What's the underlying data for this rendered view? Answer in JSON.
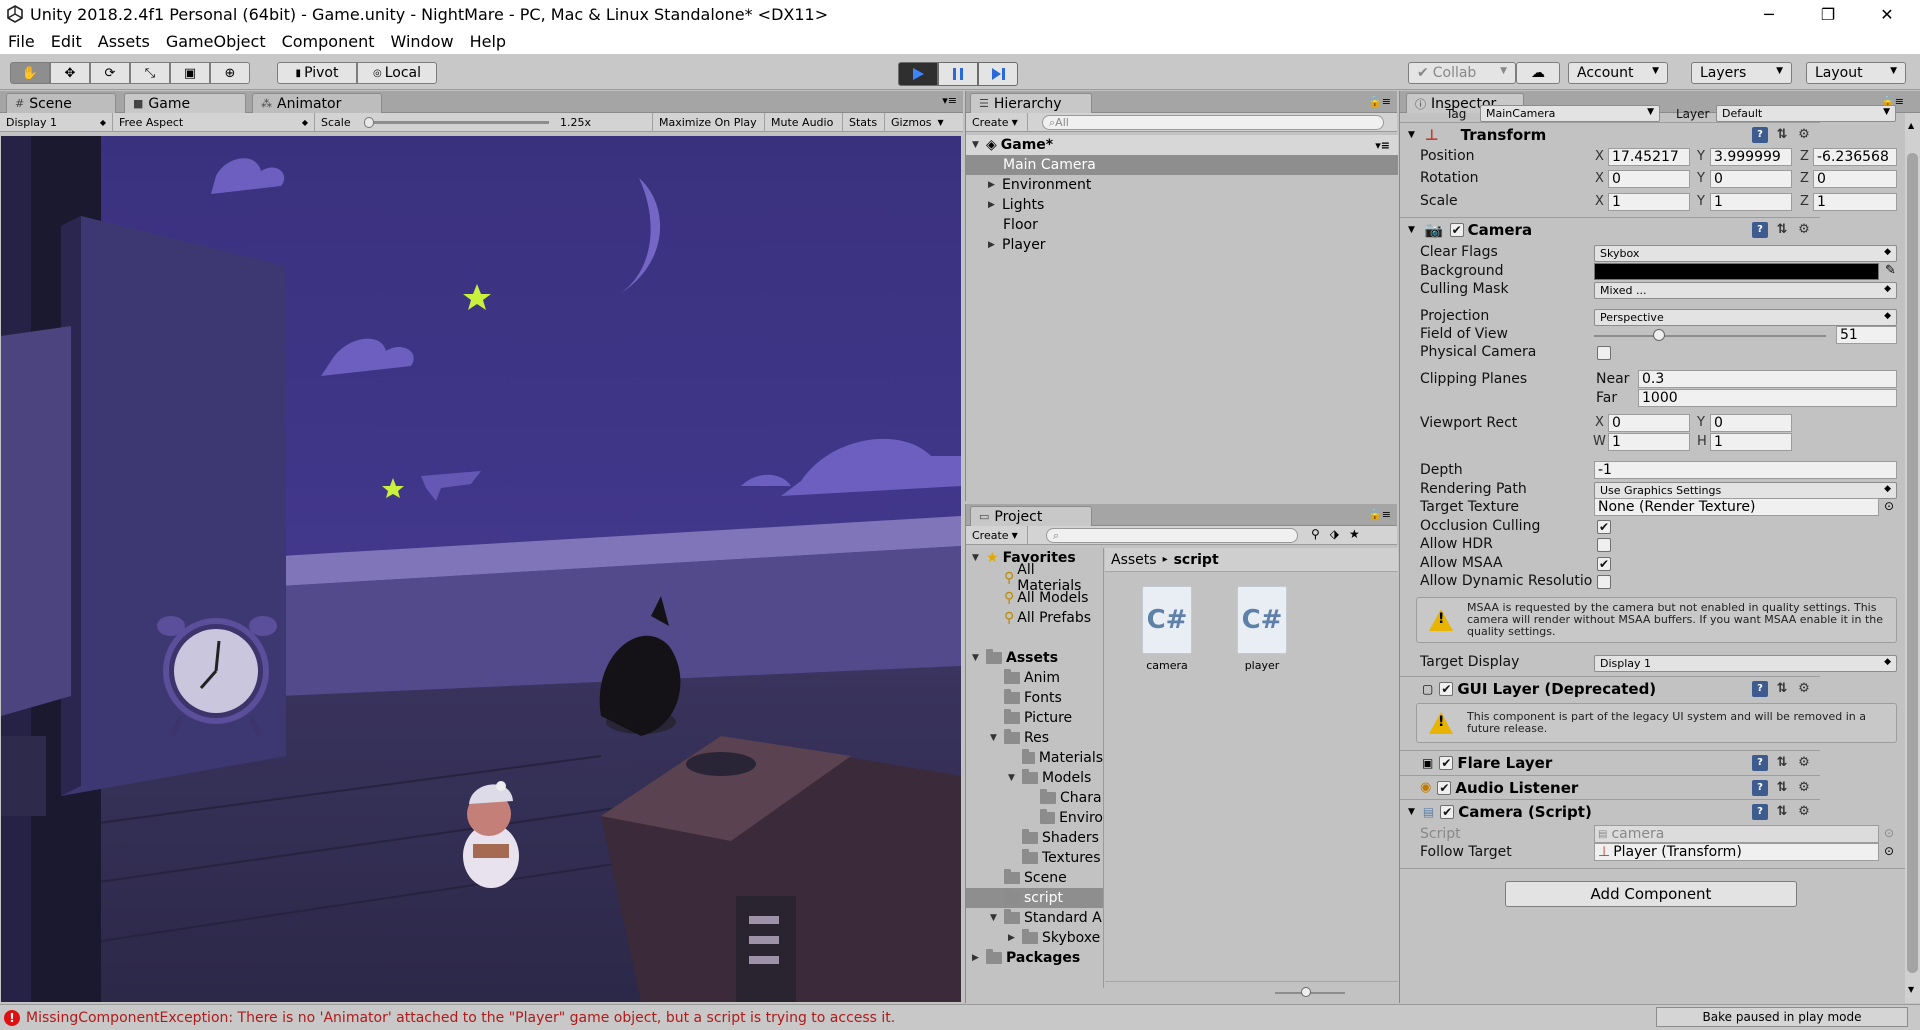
{
  "window": {
    "title": "Unity 2018.2.4f1 Personal (64bit) - Game.unity - NightMare - PC, Mac & Linux Standalone* <DX11>",
    "minimize": "─",
    "restore": "❐",
    "close": "✕"
  },
  "menu": [
    "File",
    "Edit",
    "Assets",
    "GameObject",
    "Component",
    "Window",
    "Help"
  ],
  "toolbar": {
    "pivot": "Pivot",
    "local": "Local",
    "collab": "Collab",
    "account": "Account",
    "layers": "Layers",
    "layout": "Layout"
  },
  "scene_tabs": {
    "scene": "Scene",
    "game": "Game",
    "animator": "Animator"
  },
  "game_bar": {
    "display": "Display 1",
    "aspect": "Free Aspect",
    "scale_label": "Scale",
    "scale_value": "1.25x",
    "scale_fraction": 0.02,
    "maximize": "Maximize On Play",
    "mute": "Mute Audio",
    "stats": "Stats",
    "gizmos": "Gizmos"
  },
  "hierarchy": {
    "title": "Hierarchy",
    "create": "Create",
    "search": "All",
    "scene": "Game*",
    "items": [
      "Main Camera",
      "Environment",
      "Lights",
      "Floor",
      "Player"
    ]
  },
  "project": {
    "title": "Project",
    "create": "Create",
    "favorites": "Favorites",
    "fav_items": [
      "All Materials",
      "All Models",
      "All Prefabs"
    ],
    "assets": "Assets",
    "tree": [
      "Anim",
      "Fonts",
      "Picture",
      "Res",
      "Materials",
      "Models",
      "Chara",
      "Enviro",
      "Shaders",
      "Textures",
      "Scene",
      "script",
      "Standard A",
      "Skyboxe"
    ],
    "packages": "Packages",
    "breadcrumb_root": "Assets",
    "breadcrumb_sep": "▸",
    "breadcrumb_cur": "script",
    "files": [
      {
        "icon": "C#",
        "name": "camera"
      },
      {
        "icon": "C#",
        "name": "player"
      }
    ]
  },
  "inspector": {
    "title": "Inspector",
    "tag_label": "Tag",
    "tag_value": "MainCamera",
    "layer_label": "Layer",
    "layer_value": "Default",
    "transform": {
      "title": "Transform",
      "position": "Position",
      "rotation": "Rotation",
      "scale": "Scale",
      "px": "17.45217",
      "py": "3.999999",
      "pz": "-6.236568",
      "rx": "0",
      "ry": "0",
      "rz": "0",
      "sx": "1",
      "sy": "1",
      "sz": "1"
    },
    "camera": {
      "title": "Camera",
      "clear_flags": "Clear Flags",
      "clear_flags_v": "Skybox",
      "background": "Background",
      "background_color": "#000000",
      "culling_mask": "Culling Mask",
      "culling_mask_v": "Mixed ...",
      "projection": "Projection",
      "projection_v": "Perspective",
      "fov": "Field of View",
      "fov_v": "51",
      "fov_fraction": 0.28,
      "physical": "Physical Camera",
      "clipping": "Clipping Planes",
      "near_l": "Near",
      "near_v": "0.3",
      "far_l": "Far",
      "far_v": "1000",
      "viewport": "Viewport Rect",
      "vx": "0",
      "vy": "0",
      "vw": "1",
      "vh": "1",
      "depth": "Depth",
      "depth_v": "-1",
      "rendering_path": "Rendering Path",
      "rendering_path_v": "Use Graphics Settings",
      "target_texture": "Target Texture",
      "target_texture_v": "None (Render Texture)",
      "occlusion": "Occlusion Culling",
      "hdr": "Allow HDR",
      "msaa": "Allow MSAA",
      "dynres": "Allow Dynamic Resolutio",
      "msaa_warning": "MSAA is requested by the camera but not enabled in quality settings. This camera will render without MSAA buffers. If you want MSAA enable it in the quality settings.",
      "target_display": "Target Display",
      "target_display_v": "Display 1"
    },
    "gui_layer": {
      "title": "GUI Layer (Deprecated)",
      "warning": "This component is part of the legacy UI system and will be removed in a future release."
    },
    "flare": {
      "title": "Flare Layer"
    },
    "audio": {
      "title": "Audio Listener"
    },
    "script": {
      "title": "Camera (Script)",
      "script_l": "Script",
      "script_v": "camera",
      "follow_l": "Follow Target",
      "follow_v": "Player (Transform)"
    },
    "add_component": "Add Component"
  },
  "status": {
    "error": "MissingComponentException: There is no 'Animator' attached to the \"Player\" game object, but a script is trying to access it.",
    "bake": "Bake paused in play mode"
  },
  "colors": {
    "sky": "#3d3383",
    "play_blue": "#2a6ad8",
    "error_red": "#b01a1a"
  }
}
